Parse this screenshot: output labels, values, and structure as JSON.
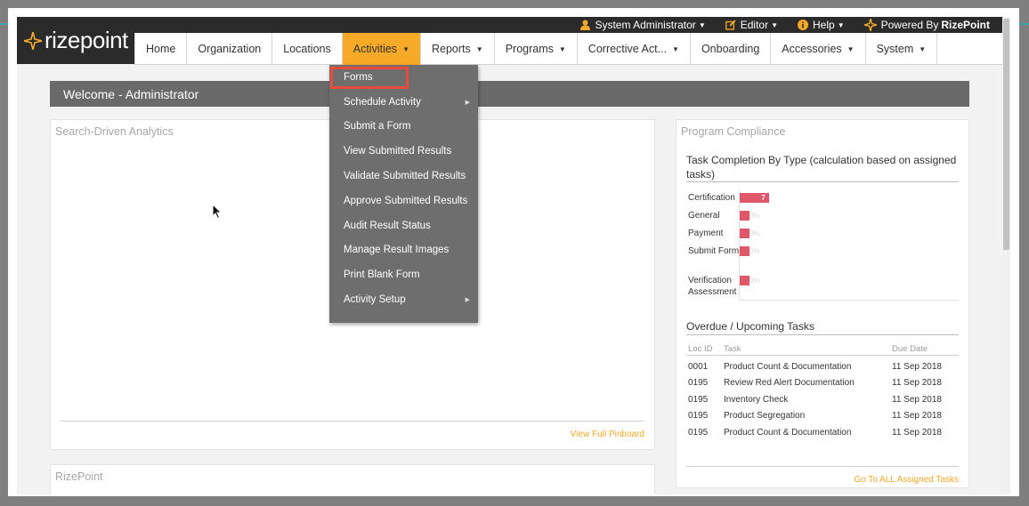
{
  "brand": {
    "name": "rizepoint"
  },
  "topbar": {
    "user": "System Administrator",
    "editor": "Editor",
    "help": "Help",
    "powered_prefix": "Powered By",
    "powered_brand": "RizePoint"
  },
  "nav": {
    "items": [
      "Home",
      "Organization",
      "Locations",
      "Activities",
      "Reports",
      "Programs",
      "Corrective Act...",
      "Onboarding",
      "Accessories",
      "System"
    ],
    "active": "Activities"
  },
  "welcome": "Welcome - Administrator",
  "analytics": {
    "title": "Search-Driven Analytics",
    "link": "View Full Pinboard"
  },
  "rizepoint_panel": {
    "title": "RizePoint"
  },
  "dropdown": {
    "items": [
      "Forms",
      "Schedule Activity",
      "Submit a Form",
      "View Submitted Results",
      "Validate Submitted Results",
      "Approve Submitted Results",
      "Audit Result Status",
      "Manage Result Images",
      "Print Blank Form",
      "Activity Setup"
    ],
    "highlighted": "Forms"
  },
  "compliance": {
    "title": "Program Compliance",
    "chart_title": "Task Completion By Type (calculation based on assigned tasks)",
    "chart_data": {
      "type": "bar",
      "categories": [
        "Certification",
        "General",
        "Payment",
        "Submit Form",
        "Verification Assessment"
      ],
      "values": [
        7,
        0,
        0,
        0,
        0
      ],
      "value_labels": [
        "7",
        "0%",
        "0%",
        "0%",
        "0%"
      ]
    },
    "tasks_title": "Overdue / Upcoming Tasks",
    "columns": [
      "Loc ID",
      "Task",
      "Due Date"
    ],
    "rows": [
      [
        "0001",
        "Product Count & Documentation",
        "11 Sep 2018"
      ],
      [
        "0195",
        "Review Red Alert Documentation",
        "11 Sep 2018"
      ],
      [
        "0195",
        "Inventory Check",
        "11 Sep 2018"
      ],
      [
        "0195",
        "Product Segregation",
        "11 Sep 2018"
      ],
      [
        "0195",
        "Product Count & Documentation",
        "11 Sep 2018"
      ]
    ],
    "link": "Go To ALL Assigned Tasks"
  }
}
